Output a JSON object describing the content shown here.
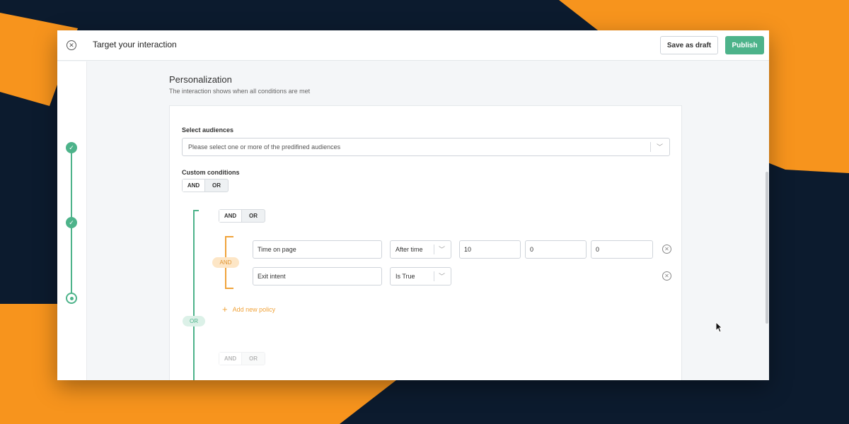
{
  "header": {
    "close_icon": "close-circle-icon",
    "title": "Target your interaction",
    "save_draft_label": "Save as draft",
    "publish_label": "Publish",
    "publish_color": "#4db38a"
  },
  "stepper": {
    "steps": [
      {
        "state": "done",
        "icon": "check-icon"
      },
      {
        "state": "done",
        "icon": "check-icon"
      },
      {
        "state": "current",
        "icon": "dot-icon"
      }
    ]
  },
  "personalization": {
    "title": "Personalization",
    "subtitle": "The interaction shows when all conditions are met",
    "audiences": {
      "label": "Select audiences",
      "placeholder": "Please select one or more of the predifined audiences"
    },
    "custom_conditions": {
      "label": "Custom conditions",
      "toggle": {
        "and": "AND",
        "or": "OR",
        "selected": "AND"
      },
      "group_connector": "OR",
      "group": {
        "toggle": {
          "and": "AND",
          "or": "OR",
          "selected": "AND"
        },
        "policy_connector": "AND",
        "policies": [
          {
            "attribute": "Time on page",
            "operator": "After time",
            "values": [
              "10",
              "0",
              "0"
            ]
          },
          {
            "attribute": "Exit intent",
            "operator": "Is True",
            "values": []
          }
        ],
        "add_policy_label": "Add new policy"
      },
      "next_group_toggle": {
        "and": "AND",
        "or": "OR"
      }
    }
  },
  "colors": {
    "accent_green": "#4db38a",
    "accent_orange": "#f0a33a",
    "background_navy": "#0c1b2e",
    "background_orange": "#f7941d"
  }
}
